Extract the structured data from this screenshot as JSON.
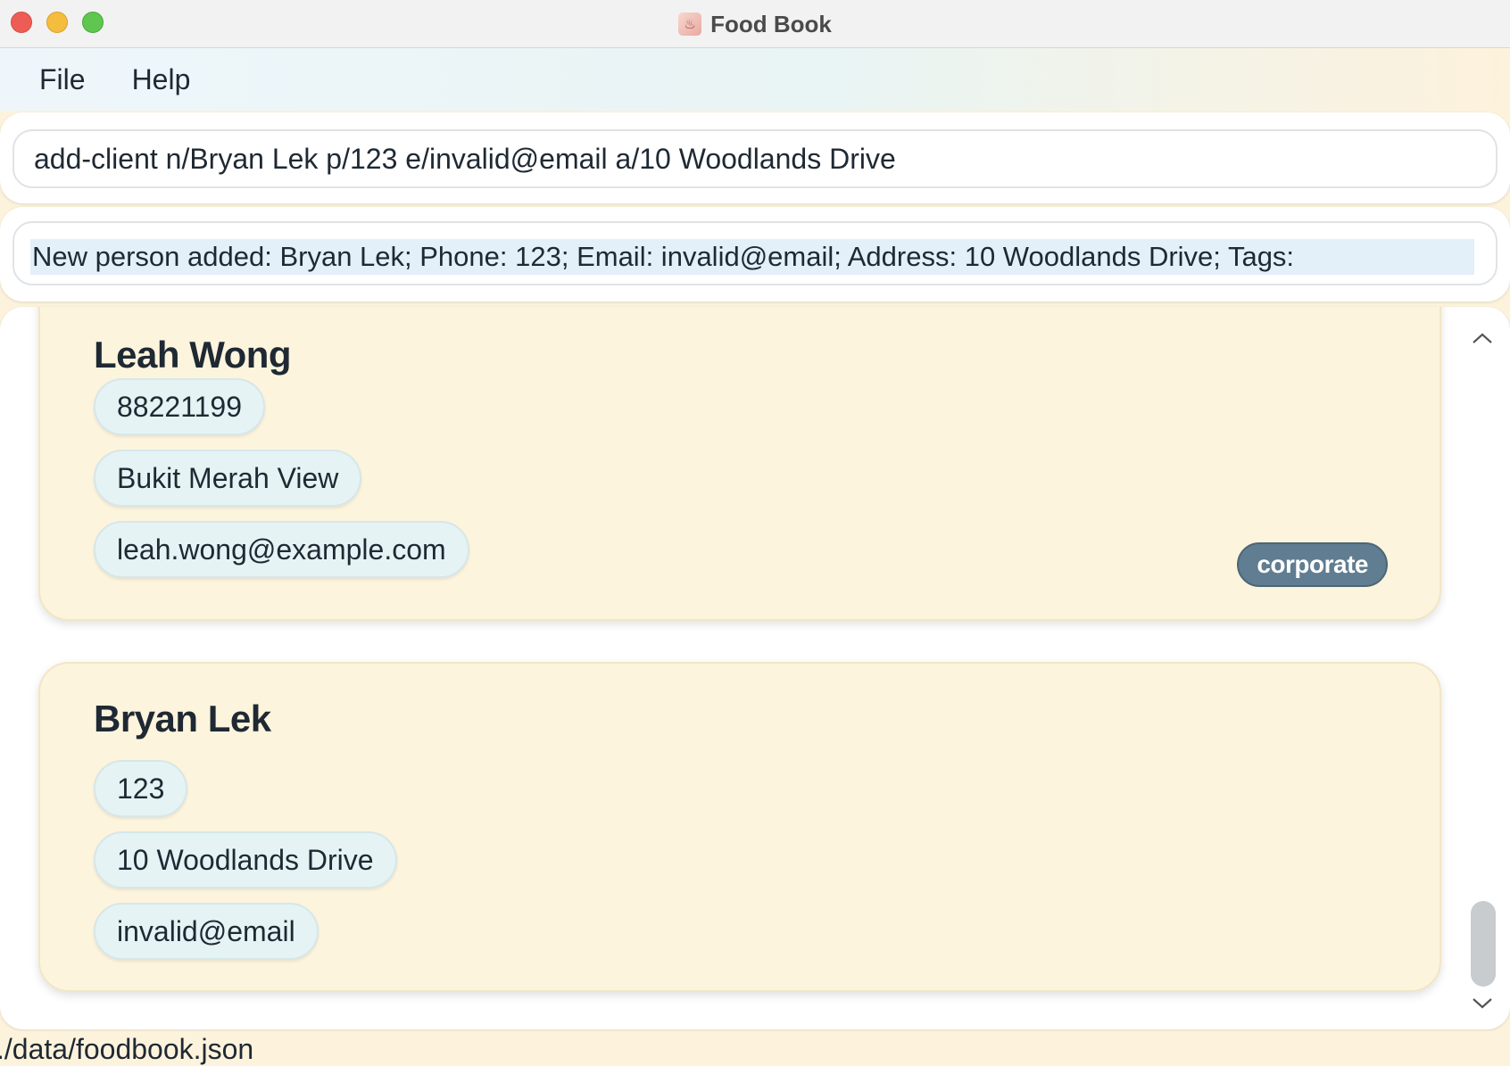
{
  "window": {
    "title": "Food Book",
    "app_icon": "food-book-app-icon"
  },
  "menu": {
    "items": [
      {
        "label": "File"
      },
      {
        "label": "Help"
      }
    ]
  },
  "command": {
    "value": "add-client n/Bryan Lek p/123 e/invalid@email a/10 Woodlands Drive"
  },
  "result": {
    "text": "New person added: Bryan Lek; Phone: 123; Email: invalid@email; Address: 10 Woodlands Drive; Tags:"
  },
  "clients": [
    {
      "name": "Leah Wong",
      "phone": "88221199",
      "address": "Bukit Merah View",
      "email": "leah.wong@example.com",
      "tags": [
        "corporate"
      ]
    },
    {
      "name": "Bryan Lek",
      "phone": "123",
      "address": "10 Woodlands Drive",
      "email": "invalid@email",
      "tags": []
    }
  ],
  "status": {
    "path": "./data/foodbook.json"
  },
  "colors": {
    "card_background": "#fdf4dd",
    "chip_background": "#e6f3f4",
    "tag_background": "#607d91",
    "result_highlight": "#e3eff9"
  }
}
